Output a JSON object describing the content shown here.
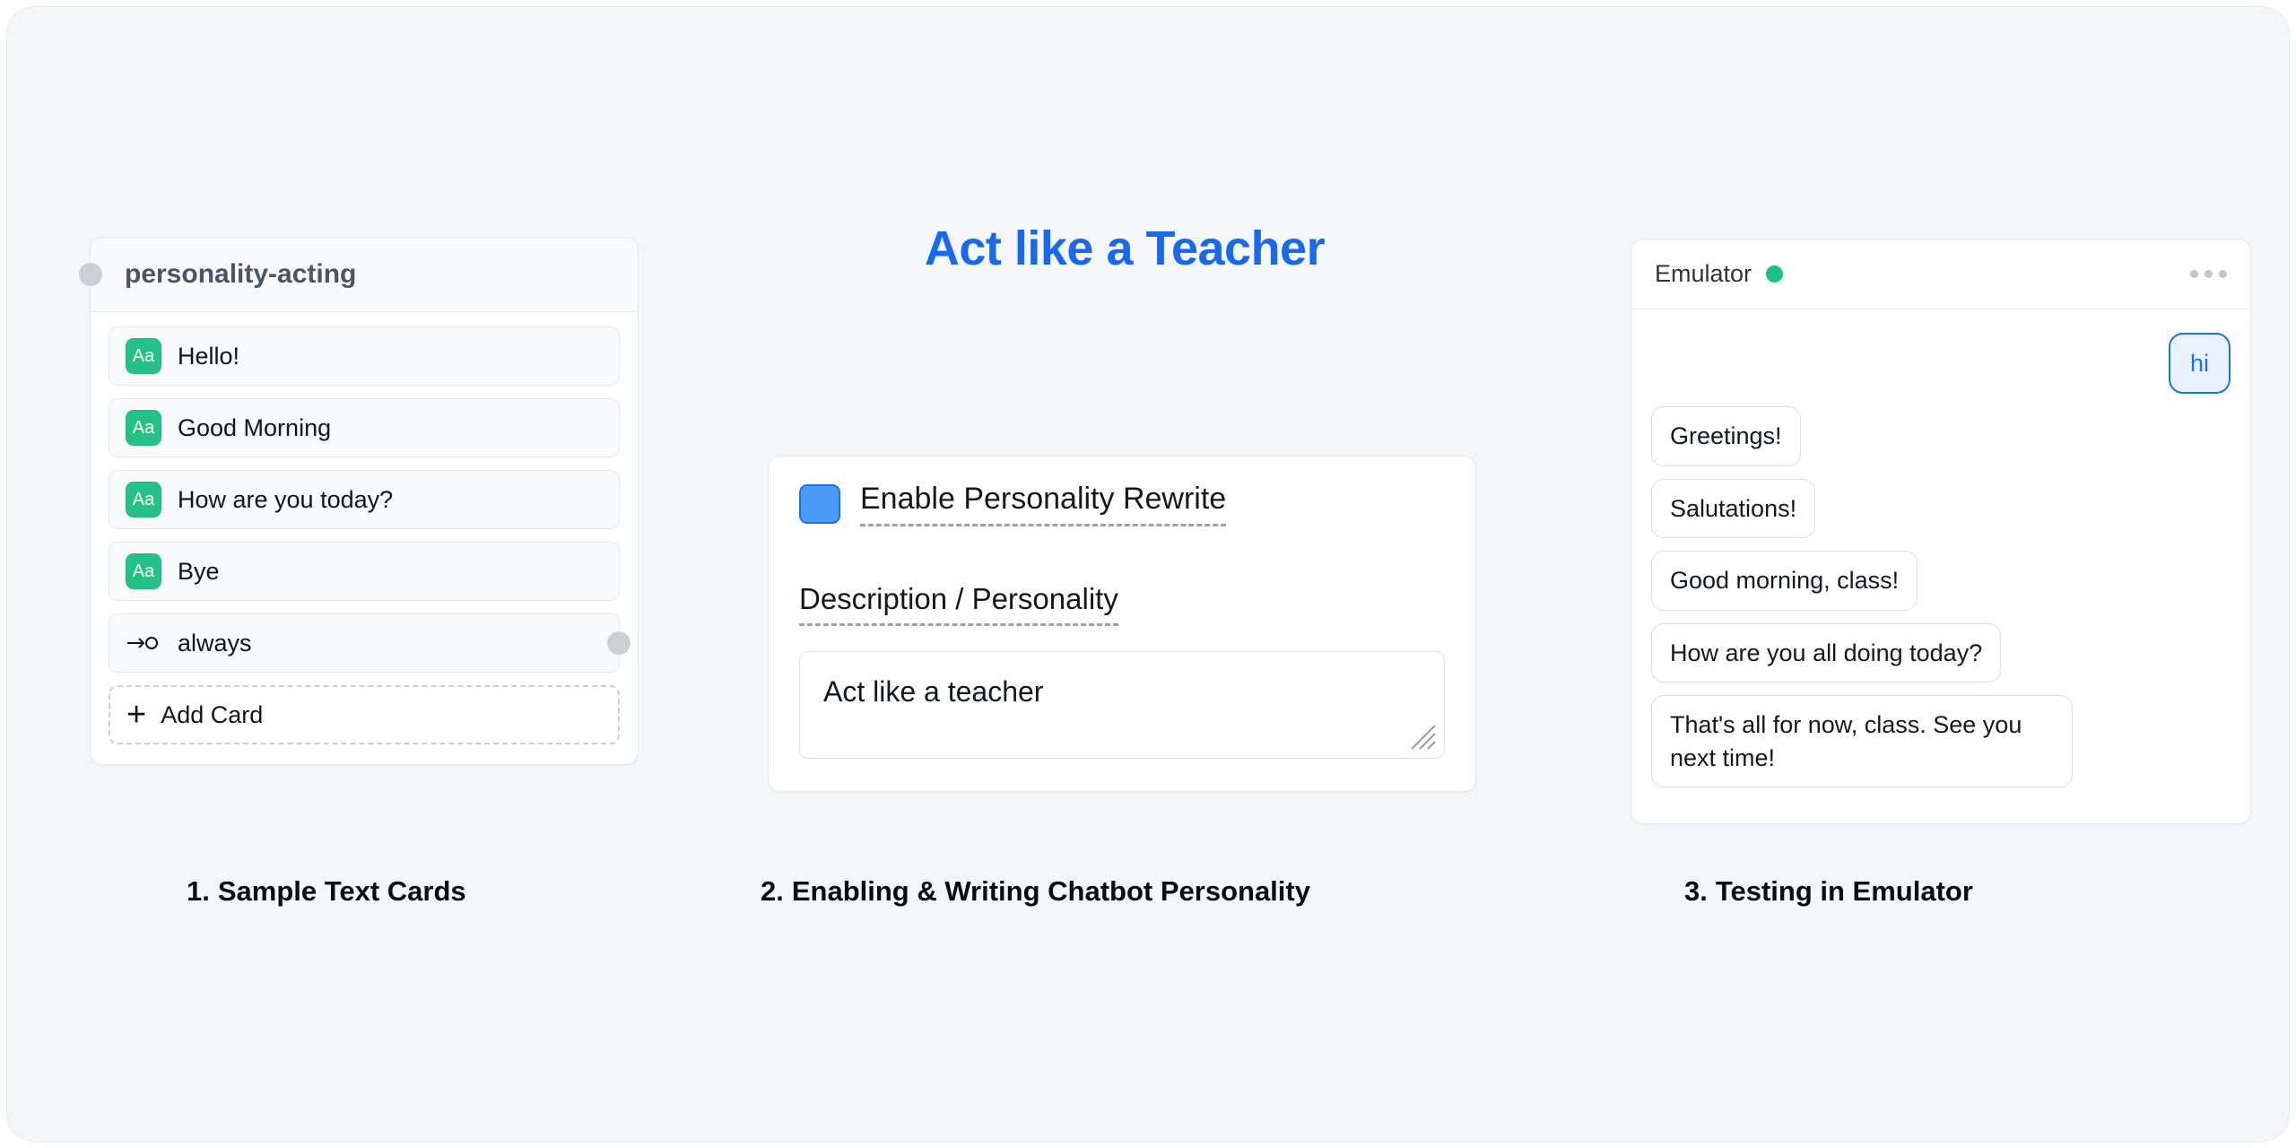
{
  "title": "Act like a Teacher",
  "colors": {
    "accent_blue": "#1769ef",
    "badge_green": "#25c186",
    "status_green": "#18c27f",
    "canvas_bg": "#f4f6f8",
    "checkbox_blue": "#4a9bf7",
    "user_bubble_blue": "#1a73e8"
  },
  "panel1": {
    "card_title": "personality-acting",
    "rows": [
      {
        "icon": "aa-text-icon",
        "icon_label": "Aa",
        "label": "Hello!"
      },
      {
        "icon": "aa-text-icon",
        "icon_label": "Aa",
        "label": "Good Morning"
      },
      {
        "icon": "aa-text-icon",
        "icon_label": "Aa",
        "label": "How are you today?"
      },
      {
        "icon": "aa-text-icon",
        "icon_label": "Aa",
        "label": "Bye"
      }
    ],
    "goto_row": {
      "icon": "goto-arrow-icon",
      "label": "always"
    },
    "add_card": {
      "icon": "plus-icon",
      "label": "Add Card"
    },
    "caption_number": "1.",
    "caption": "Sample Text Cards"
  },
  "panel2": {
    "checkbox_label": "Enable Personality Rewrite",
    "checkbox_checked": true,
    "field_label": "Description / Personality",
    "textarea_value": "Act like a teacher",
    "resize_handle": "resize-grip-icon",
    "caption_number": "2.",
    "caption": "Enabling & Writing Chatbot Personality"
  },
  "panel3": {
    "header_title": "Emulator",
    "status": "online",
    "menu_icon": "more-options-icon",
    "messages": [
      {
        "from": "user",
        "text": "hi"
      },
      {
        "from": "bot",
        "text": "Greetings!"
      },
      {
        "from": "bot",
        "text": "Salutations!"
      },
      {
        "from": "bot",
        "text": "Good morning, class!"
      },
      {
        "from": "bot",
        "text": "How are you all doing today?"
      },
      {
        "from": "bot",
        "text": "That's all for now, class. See you next time!"
      }
    ],
    "caption_number": "3.",
    "caption": "Testing in Emulator"
  }
}
